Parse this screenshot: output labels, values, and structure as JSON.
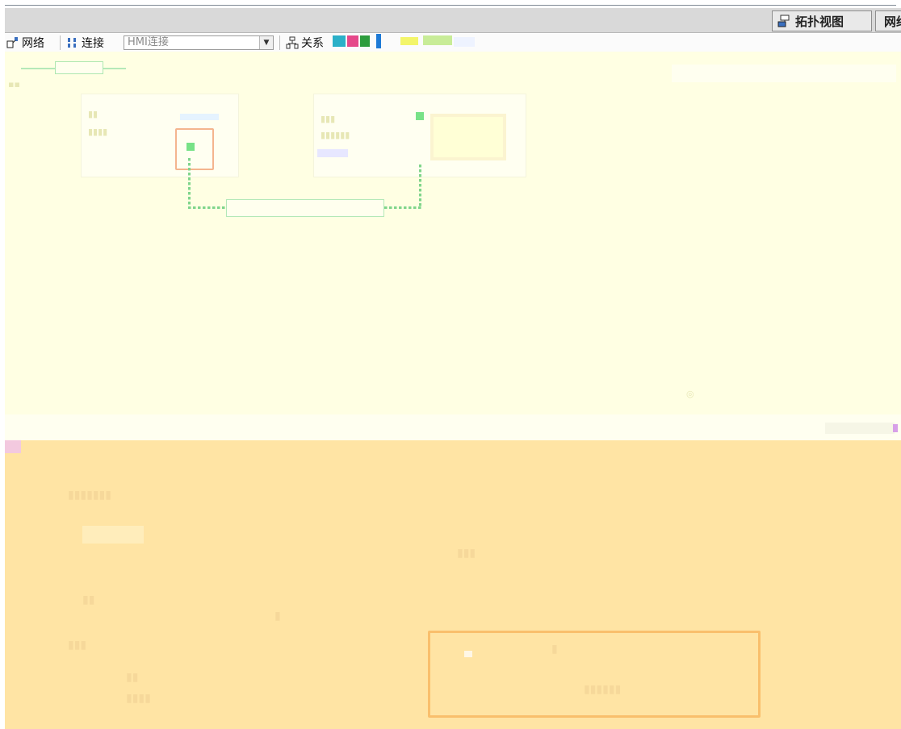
{
  "view_tabs": {
    "topology": "拓扑视图",
    "network": "网络视图"
  },
  "toolbar": {
    "network_label": "网络",
    "connect_label": "连接",
    "connection_type_value": "HMI连接",
    "relation_label": "关系"
  },
  "colors": {
    "canvas_bg": "#ffffe3",
    "inspector_bg": "#ffe4a4",
    "link": "#7fd58a",
    "port": "#78e287",
    "port_highlight": "#f4b58e",
    "frame": "#f9bf6c"
  }
}
